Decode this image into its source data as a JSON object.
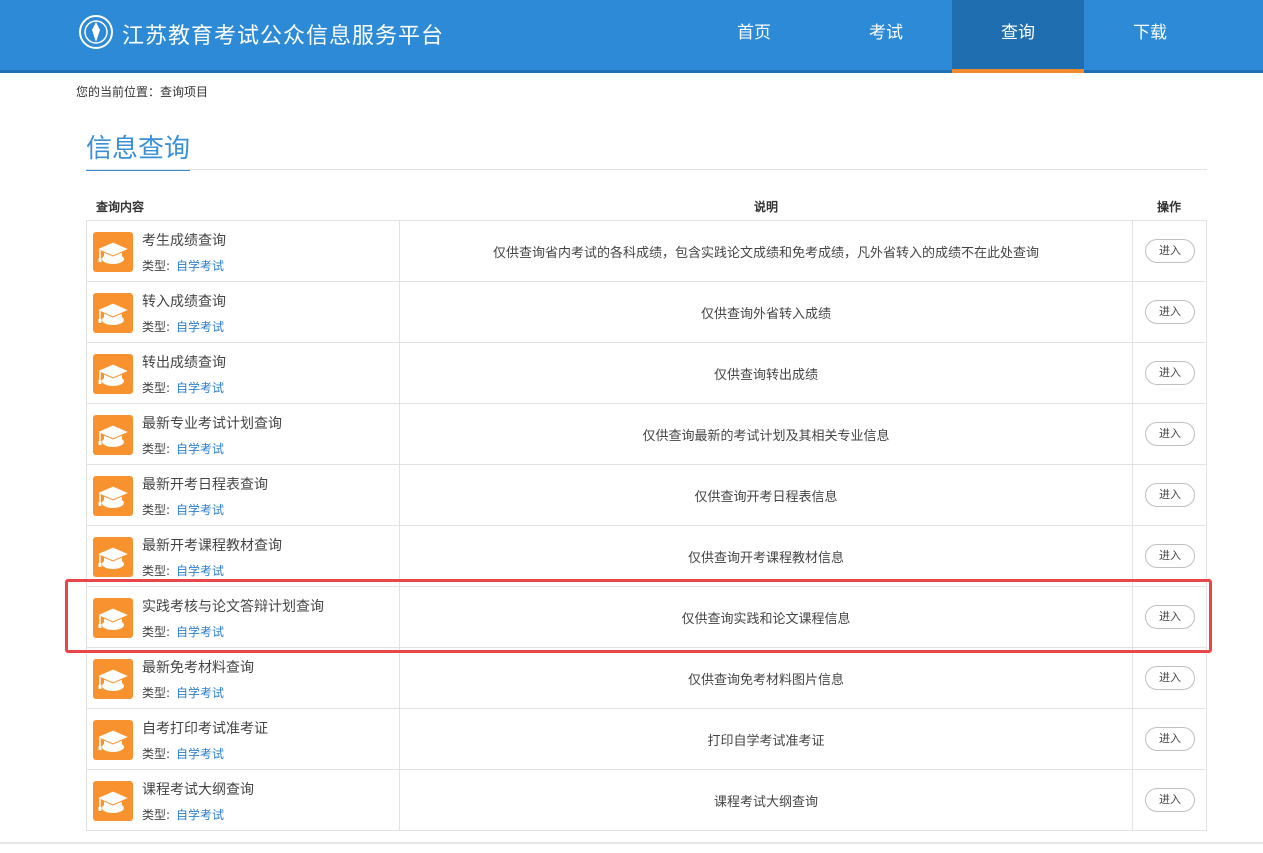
{
  "header": {
    "site_title": "江苏教育考试公众信息服务平台",
    "logo_icon": "emblem-logo-icon",
    "nav": [
      {
        "label": "首页",
        "active": false
      },
      {
        "label": "考试",
        "active": false
      },
      {
        "label": "查询",
        "active": true
      },
      {
        "label": "下载",
        "active": false
      }
    ]
  },
  "breadcrumb": {
    "text": "您的当前位置：查询项目"
  },
  "section": {
    "title": "信息查询"
  },
  "table": {
    "headers": {
      "content": "查询内容",
      "description": "说明",
      "action": "操作"
    },
    "type_label": "类型:",
    "rows": [
      {
        "title": "考生成绩查询",
        "type": "自学考试",
        "description": "仅供查询省内考试的各科成绩，包含实践论文成绩和免考成绩，凡外省转入的成绩不在此处查询",
        "action": "进入"
      },
      {
        "title": "转入成绩查询",
        "type": "自学考试",
        "description": "仅供查询外省转入成绩",
        "action": "进入"
      },
      {
        "title": "转出成绩查询",
        "type": "自学考试",
        "description": "仅供查询转出成绩",
        "action": "进入"
      },
      {
        "title": "最新专业考试计划查询",
        "type": "自学考试",
        "description": "仅供查询最新的考试计划及其相关专业信息",
        "action": "进入"
      },
      {
        "title": "最新开考日程表查询",
        "type": "自学考试",
        "description": "仅供查询开考日程表信息",
        "action": "进入"
      },
      {
        "title": "最新开考课程教材查询",
        "type": "自学考试",
        "description": "仅供查询开考课程教材信息",
        "action": "进入"
      },
      {
        "title": "实践考核与论文答辩计划查询",
        "type": "自学考试",
        "description": "仅供查询实践和论文课程信息",
        "action": "进入"
      },
      {
        "title": "最新免考材料查询",
        "type": "自学考试",
        "description": "仅供查询免考材料图片信息",
        "action": "进入"
      },
      {
        "title": "自考打印考试准考证",
        "type": "自学考试",
        "description": "打印自学考试准考证",
        "action": "进入"
      },
      {
        "title": "课程考试大纲查询",
        "type": "自学考试",
        "description": "课程考试大纲查询",
        "action": "进入"
      }
    ],
    "row_icon": "graduation-cap-icon"
  },
  "colors": {
    "header": "#2c8ad6",
    "nav_active": "#1e6eb0",
    "accent_orange": "#f7922e",
    "link_blue": "#2c7fcc",
    "highlight_red": "#e8464a"
  }
}
